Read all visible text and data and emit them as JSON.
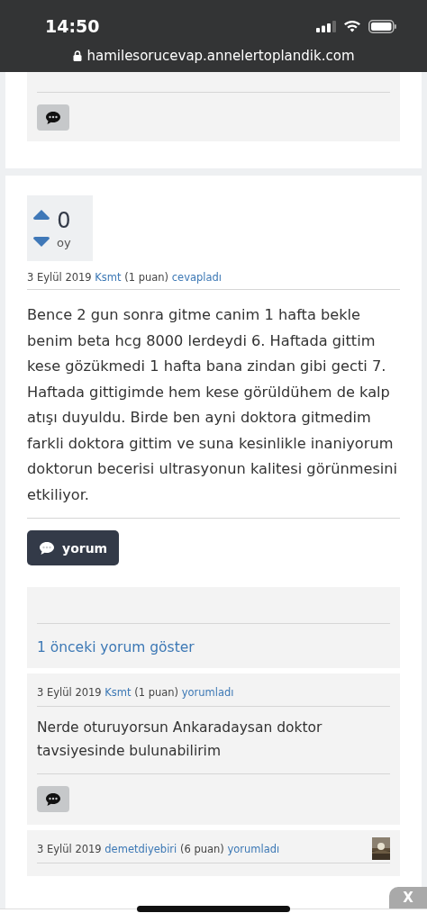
{
  "status_bar": {
    "time": "14:50",
    "url": "hamilesorucevap.annelertoplandik.com"
  },
  "answer": {
    "votes": "0",
    "votes_label": "oy",
    "meta": {
      "date": "3 Eylül 2019",
      "user": "Ksmt",
      "points": "(1 puan)",
      "action": "cevapladı"
    },
    "body": "Bence 2 gun sonra gitme canim 1 hafta bekle benim beta hcg 8000 lerdeydi 6. Haftada gittim kese gözükmedi 1 hafta bana zindan gibi gecti 7. Haftada gittigimde hem kese görüldühem de kalp atışı duyuldu. Birde ben ayni doktora gitmedim farkli doktora gittim ve suna kesinlikle inaniyorum doktorun becerisi ultrasyonun kalitesi görünmesini etkiliyor.",
    "comment_button": "yorum"
  },
  "comments": {
    "show_previous": "1 önceki yorum göster",
    "items": [
      {
        "meta": {
          "date": "3 Eylül 2019",
          "user": "Ksmt",
          "points": "(1 puan)",
          "action": "yorumladı"
        },
        "text": "Nerde oturuyorsun Ankaradaysan doktor tavsiyesinde bulunabilirim",
        "has_avatar": false
      },
      {
        "meta": {
          "date": "3 Eylül 2019",
          "user": "demetdiyebiri",
          "points": "(6 puan)",
          "action": "yorumladı"
        },
        "has_avatar": true
      }
    ]
  },
  "ad_close": "X"
}
